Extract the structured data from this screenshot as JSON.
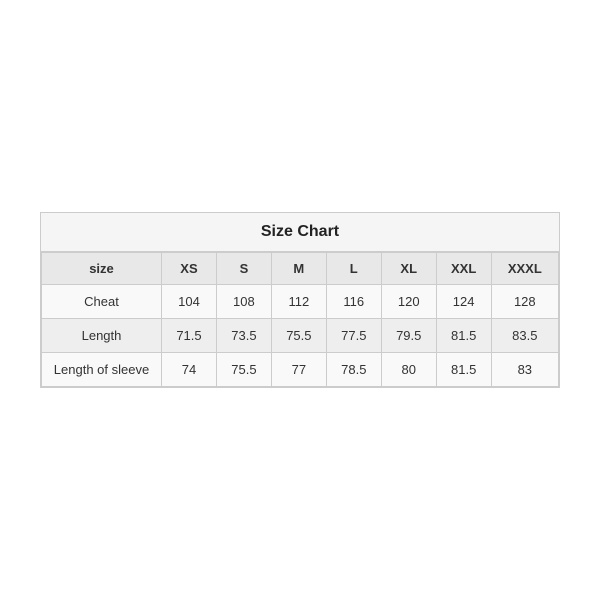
{
  "chart": {
    "title": "Size Chart",
    "columns": [
      "size",
      "XS",
      "S",
      "M",
      "L",
      "XL",
      "XXL",
      "XXXL"
    ],
    "rows": [
      {
        "label": "Cheat",
        "values": [
          "104",
          "108",
          "112",
          "116",
          "120",
          "124",
          "128"
        ]
      },
      {
        "label": "Length",
        "values": [
          "71.5",
          "73.5",
          "75.5",
          "77.5",
          "79.5",
          "81.5",
          "83.5"
        ]
      },
      {
        "label": "Length of sleeve",
        "values": [
          "74",
          "75.5",
          "77",
          "78.5",
          "80",
          "81.5",
          "83"
        ]
      }
    ]
  }
}
